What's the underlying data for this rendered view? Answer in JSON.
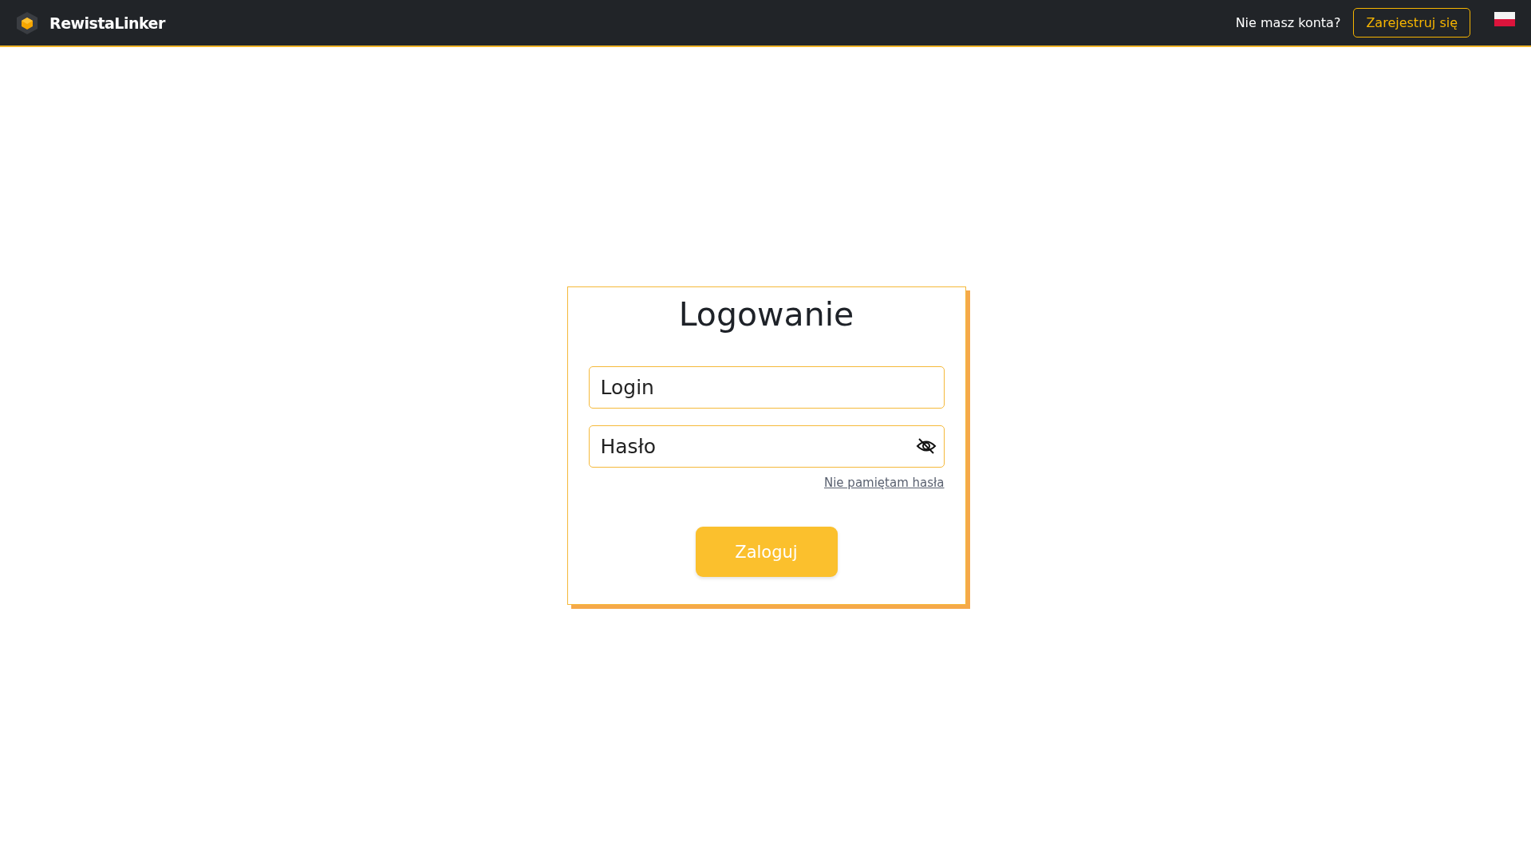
{
  "navbar": {
    "brand": "RewistaLinker",
    "prompt": "Nie masz konta?",
    "register_button": "Zarejestruj się"
  },
  "login_card": {
    "title": "Logowanie",
    "fields": [
      {
        "kind": "text",
        "placeholder": "Login"
      },
      {
        "kind": "password",
        "placeholder": "Hasło"
      }
    ],
    "forgot_link": "Nie pamiętam hasła",
    "submit_button": "Zaloguj"
  }
}
